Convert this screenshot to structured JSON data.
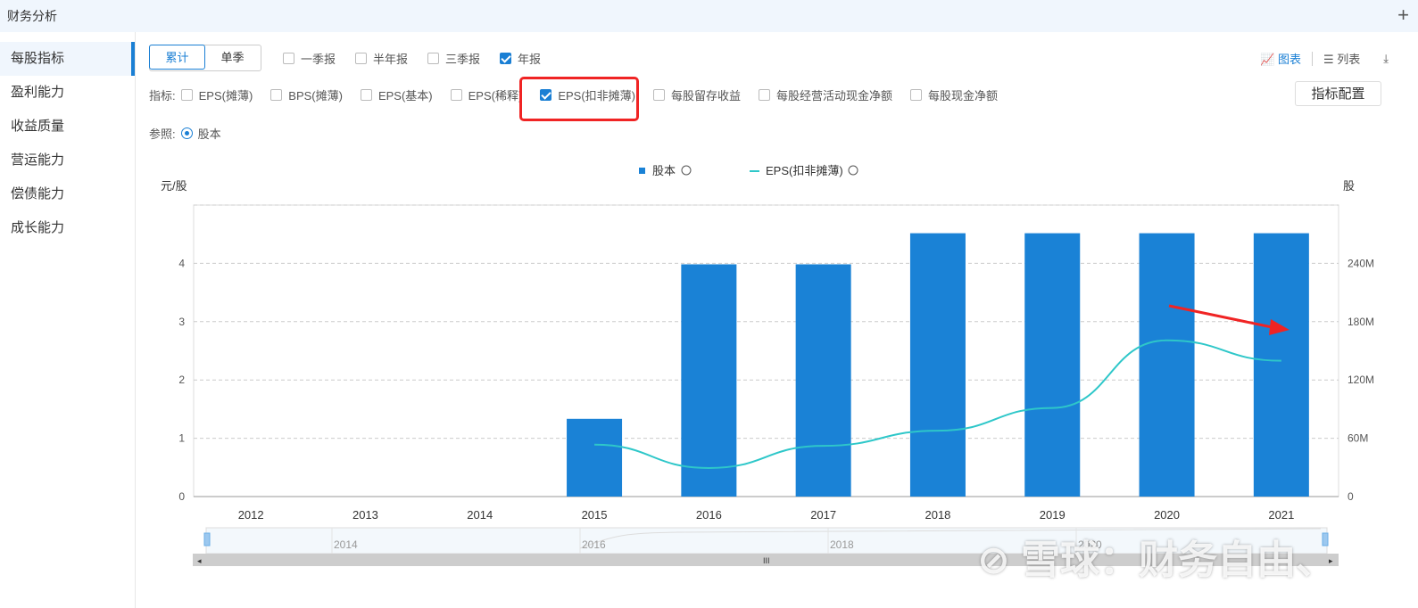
{
  "header": {
    "title": "财务分析",
    "add_icon": "plus-icon"
  },
  "sidebar": {
    "items": [
      {
        "label": "每股指标",
        "active": true
      },
      {
        "label": "盈利能力"
      },
      {
        "label": "收益质量"
      },
      {
        "label": "营运能力"
      },
      {
        "label": "偿债能力"
      },
      {
        "label": "成长能力"
      }
    ]
  },
  "mode": {
    "cumulative": "累计",
    "single": "单季",
    "selected": "累计"
  },
  "periods": [
    {
      "label": "一季报",
      "checked": false
    },
    {
      "label": "半年报",
      "checked": false
    },
    {
      "label": "三季报",
      "checked": false
    },
    {
      "label": "年报",
      "checked": true
    }
  ],
  "indicators": {
    "label": "指标:",
    "items": [
      {
        "label": "EPS(摊薄)",
        "checked": false
      },
      {
        "label": "BPS(摊薄)",
        "checked": false
      },
      {
        "label": "EPS(基本)",
        "checked": false
      },
      {
        "label": "EPS(稀释)",
        "checked": false
      },
      {
        "label": "EPS(扣非摊薄)",
        "checked": true
      },
      {
        "label": "每股留存收益",
        "checked": false
      },
      {
        "label": "每股经营活动现金净额",
        "checked": false
      },
      {
        "label": "每股现金净额",
        "checked": false
      }
    ],
    "config_button": "指标配置"
  },
  "reference": {
    "label": "参照:",
    "option": "股本"
  },
  "view": {
    "chart": "图表",
    "list": "列表"
  },
  "chart_data": {
    "type": "bar+line",
    "categories": [
      "2012",
      "2013",
      "2014",
      "2015",
      "2016",
      "2017",
      "2018",
      "2019",
      "2020",
      "2021"
    ],
    "legend": [
      "股本",
      "EPS(扣非摊薄)"
    ],
    "left_unit": "元/股",
    "right_unit": "股",
    "left_ticks": [
      "0",
      "1",
      "2",
      "3",
      "4"
    ],
    "left_range": [
      0,
      5
    ],
    "right_ticks": [
      "0",
      "60M",
      "120M",
      "180M",
      "240M"
    ],
    "right_range": [
      0,
      300
    ],
    "series": [
      {
        "name": "股本",
        "axis": "right",
        "type": "bar",
        "color": "#1a82d6",
        "values": [
          null,
          null,
          null,
          80,
          239,
          239,
          271,
          271,
          271,
          271
        ]
      },
      {
        "name": "EPS(扣非摊薄)",
        "axis": "left",
        "type": "line",
        "color": "#2ec7c9",
        "values": [
          null,
          null,
          null,
          0.89,
          0.49,
          0.87,
          1.13,
          1.52,
          2.68,
          2.33
        ]
      }
    ],
    "zoom_labels": [
      "2014",
      "2016",
      "2018",
      "2020"
    ]
  },
  "watermark": "雪球：财务自由、"
}
